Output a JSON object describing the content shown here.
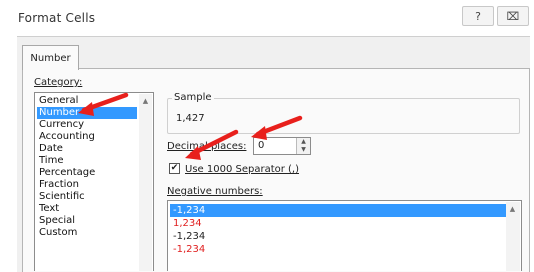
{
  "window": {
    "title": "Format Cells",
    "help_glyph": "?",
    "close_glyph": "⌧"
  },
  "tabs": [
    {
      "label": "Number",
      "active": true
    }
  ],
  "category": {
    "label": "Category:",
    "items": [
      "General",
      "Number",
      "Currency",
      "Accounting",
      "Date",
      "Time",
      "Percentage",
      "Fraction",
      "Scientific",
      "Text",
      "Special",
      "Custom"
    ],
    "selected": "Number"
  },
  "sample": {
    "label": "Sample",
    "value": "1,427"
  },
  "decimal_places": {
    "label": "Decimal places:",
    "value": "0"
  },
  "thousands_separator": {
    "label": "Use 1000 Separator (,)",
    "checked": true
  },
  "negative_numbers": {
    "label": "Negative numbers:",
    "items": [
      {
        "text": "-1,234",
        "color": "#ffffff",
        "selected": true
      },
      {
        "text": "1,234",
        "color": "#e02020",
        "selected": false
      },
      {
        "text": "-1,234",
        "color": "#222222",
        "selected": false
      },
      {
        "text": "-1,234",
        "color": "#e02020",
        "selected": false
      }
    ]
  },
  "colors": {
    "selection": "#3399ff",
    "annotation_arrow": "#e8201c",
    "negative_red": "#e02020"
  }
}
